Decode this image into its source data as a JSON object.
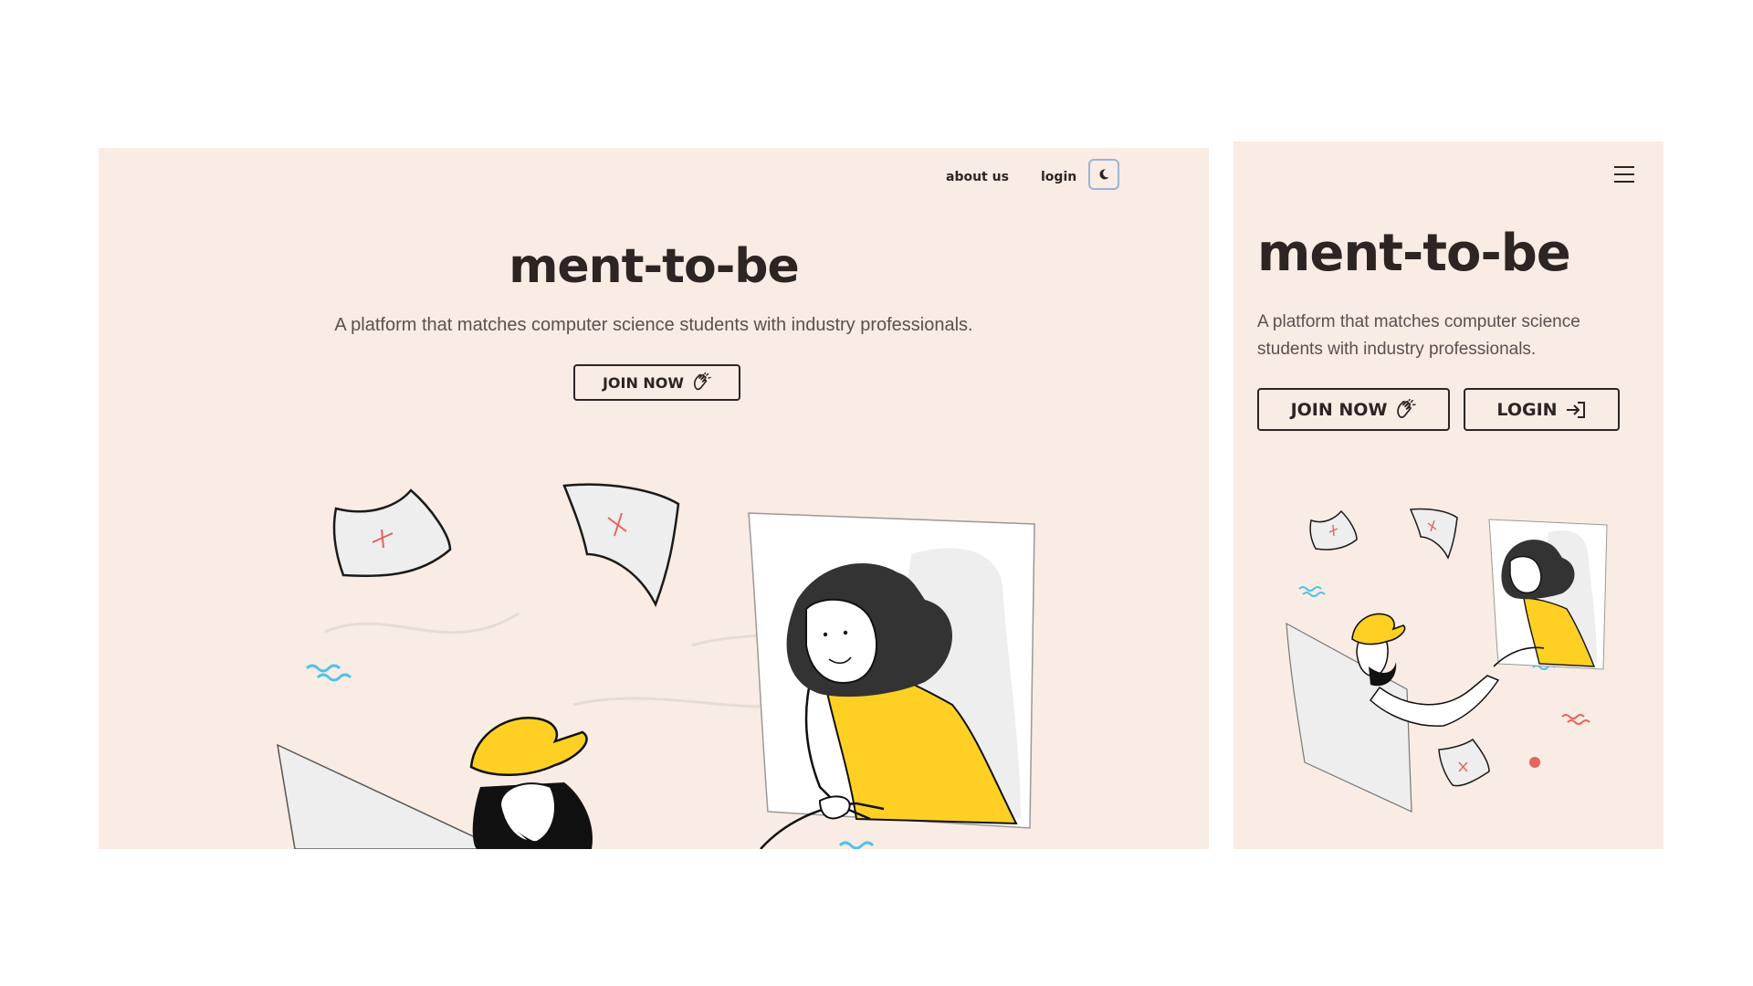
{
  "desktop": {
    "nav": {
      "about_label": "about us",
      "login_label": "login",
      "theme_icon": "moon-icon"
    },
    "hero": {
      "title": "ment-to-be",
      "subtitle": "A platform that matches computer science students with industry professionals.",
      "join_label": "JOIN NOW",
      "join_icon": "clapping-hands-icon"
    }
  },
  "mobile": {
    "nav": {
      "menu_icon": "hamburger-menu-icon"
    },
    "hero": {
      "title": "ment-to-be",
      "subtitle_line1": "A platform that matches computer science",
      "subtitle_line2": "students with industry professionals.",
      "join_label": "JOIN NOW",
      "join_icon": "clapping-hands-icon",
      "login_label": "LOGIN",
      "login_icon": "login-arrow-icon"
    }
  },
  "colors": {
    "background": "#f9ece4",
    "text": "#2d2424",
    "accent_yellow": "#fdd023",
    "hair_dark": "#333333",
    "paper_grey": "#eeeeee",
    "cross_red": "#e5645e",
    "wave_blue": "#4fc3e8"
  }
}
